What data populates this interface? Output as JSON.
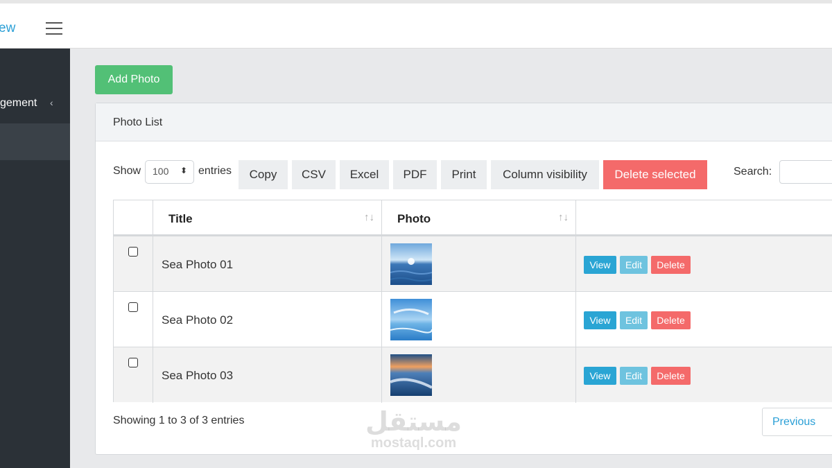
{
  "brand": {
    "text": "ew"
  },
  "sidebar": {
    "item_label": "gement",
    "item_chevron": "‹"
  },
  "main": {
    "add_button": "Add Photo",
    "card_title": "Photo List",
    "show_label": "Show",
    "entries_value": "100",
    "entries_label": "entries",
    "toolbar": {
      "copy": "Copy",
      "csv": "CSV",
      "excel": "Excel",
      "pdf": "PDF",
      "print": "Print",
      "column_visibility": "Column visibility",
      "delete_selected": "Delete selected"
    },
    "search_label": "Search:",
    "search_value": "",
    "table": {
      "headers": {
        "title": "Title",
        "photo": "Photo"
      },
      "rows": [
        {
          "title": "Sea Photo 01",
          "view": "View",
          "edit": "Edit",
          "delete": "Delete"
        },
        {
          "title": "Sea Photo 02",
          "view": "View",
          "edit": "Edit",
          "delete": "Delete"
        },
        {
          "title": "Sea Photo 03",
          "view": "View",
          "edit": "Edit",
          "delete": "Delete"
        }
      ]
    },
    "info": "Showing 1 to 3 of 3 entries",
    "pagination": {
      "previous": "Previous"
    }
  },
  "watermark": {
    "arabic": "مستقل",
    "latin": "mostaql.com"
  },
  "colors": {
    "accent": "#2a9fd6",
    "success": "#52c076",
    "danger": "#f46a6a",
    "sidebar": "#2b3137"
  }
}
